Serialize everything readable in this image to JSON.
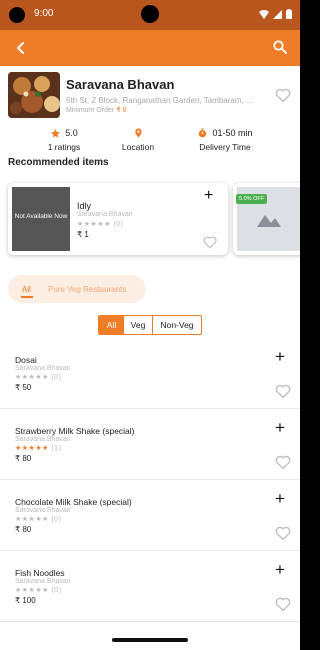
{
  "status": {
    "time": "9:00"
  },
  "restaurant": {
    "name": "Saravana Bhavan",
    "address": "6th St, Z Block, Ranganathan Garden, Tambaram, ...",
    "min_order_label": "Minimum Order",
    "min_order_value": "₹ 0"
  },
  "stats": {
    "rating_value": "5.0",
    "rating_label": "1 ratings",
    "location_label": "Location",
    "delivery_value": "01-50 min",
    "delivery_label": "Delivery Time"
  },
  "recommended": {
    "title": "Recommended items",
    "items": [
      {
        "badge": "Not Available Now",
        "name": "Idly",
        "restaurant": "Saravana Bhavan",
        "stars": "★★★★★",
        "rating_count": "(0)",
        "price": "₹ 1",
        "add": "+"
      },
      {
        "offer": "5.0% OFF"
      }
    ]
  },
  "categories": {
    "all": "All",
    "veg": "Pure Veg Restaurants"
  },
  "filters": {
    "all": "All",
    "veg": "Veg",
    "nonveg": "Non-Veg"
  },
  "menu": [
    {
      "name": "Dosai",
      "restaurant": "Saravana Bhavan",
      "stars": "★★★★★",
      "rating_count": "(0)",
      "price": "₹ 50",
      "add": "+",
      "rated": false
    },
    {
      "name": "Strawberry Milk Shake (special)",
      "restaurant": "Saravana Bhavan",
      "stars": "★★★★★",
      "rating_count": "(1)",
      "price": "₹ 80",
      "add": "+",
      "rated": true
    },
    {
      "name": "Chocolate Milk Shake (special)",
      "restaurant": "Saravana Bhavan",
      "stars": "★★★★★",
      "rating_count": "(0)",
      "price": "₹ 80",
      "add": "+",
      "rated": false
    },
    {
      "name": "Fish Noodles",
      "restaurant": "Saravana Bhavan",
      "stars": "★★★★★",
      "rating_count": "(0)",
      "price": "₹ 100",
      "add": "+",
      "rated": false
    }
  ],
  "colors": {
    "accent": "#ef7d28",
    "status_bar": "#b8561e",
    "offer_green": "#4caf50",
    "star_inactive": "#bbbbbb"
  },
  "icons": [
    "back-arrow-icon",
    "search-icon",
    "heart-outline-icon",
    "star-icon",
    "location-pin-icon",
    "stopwatch-icon",
    "plus-icon",
    "image-placeholder-icon",
    "wifi-icon",
    "signal-icon",
    "battery-icon"
  ]
}
